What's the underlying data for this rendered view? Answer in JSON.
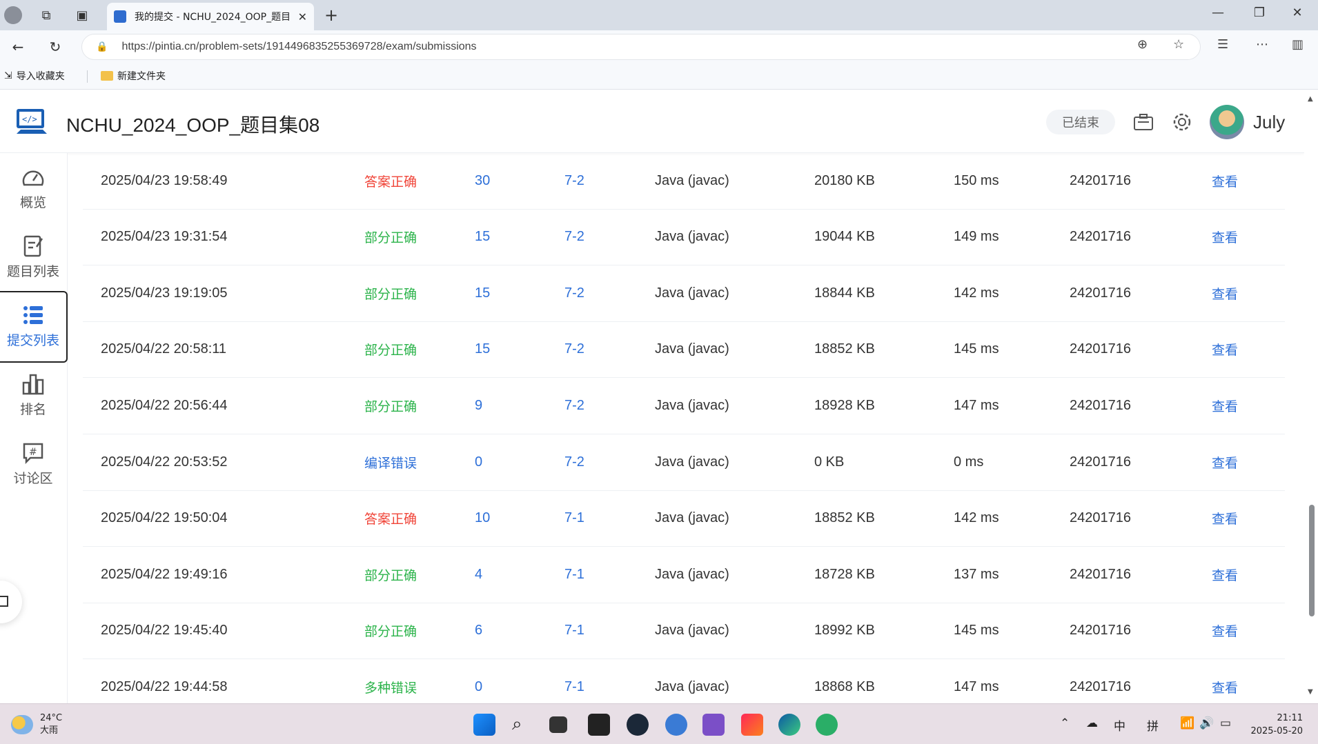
{
  "browser": {
    "tab_title": "我的提交 - NCHU_2024_OOP_题目",
    "url": "https://pintia.cn/problem-sets/1914496835255369728/exam/submissions",
    "bookmarks": [
      "导入收藏夹",
      "新建文件夹"
    ]
  },
  "header": {
    "title": "NCHU_2024_OOP_题目集08",
    "status": "已结束",
    "username": "July"
  },
  "sidebar": {
    "items": [
      {
        "label": "概览",
        "icon": "dashboard-icon"
      },
      {
        "label": "题目列表",
        "icon": "edit-list-icon"
      },
      {
        "label": "提交列表",
        "icon": "list-icon",
        "active": true
      },
      {
        "label": "排名",
        "icon": "ranking-icon"
      },
      {
        "label": "讨论区",
        "icon": "discussion-icon"
      }
    ]
  },
  "submissions": [
    {
      "time": "2025/04/23 19:58:49",
      "status": "答案正确",
      "status_color": "#f04438",
      "score": "30",
      "problem": "7-2",
      "lang": "Java (javac)",
      "memory": "20180 KB",
      "duration": "150 ms",
      "user": "24201716",
      "action": "查看"
    },
    {
      "time": "2025/04/23 19:31:54",
      "status": "部分正确",
      "status_color": "#2bb34a",
      "score": "15",
      "problem": "7-2",
      "lang": "Java (javac)",
      "memory": "19044 KB",
      "duration": "149 ms",
      "user": "24201716",
      "action": "查看"
    },
    {
      "time": "2025/04/23 19:19:05",
      "status": "部分正确",
      "status_color": "#2bb34a",
      "score": "15",
      "problem": "7-2",
      "lang": "Java (javac)",
      "memory": "18844 KB",
      "duration": "142 ms",
      "user": "24201716",
      "action": "查看"
    },
    {
      "time": "2025/04/22 20:58:11",
      "status": "部分正确",
      "status_color": "#2bb34a",
      "score": "15",
      "problem": "7-2",
      "lang": "Java (javac)",
      "memory": "18852 KB",
      "duration": "145 ms",
      "user": "24201716",
      "action": "查看"
    },
    {
      "time": "2025/04/22 20:56:44",
      "status": "部分正确",
      "status_color": "#2bb34a",
      "score": "9",
      "problem": "7-2",
      "lang": "Java (javac)",
      "memory": "18928 KB",
      "duration": "147 ms",
      "user": "24201716",
      "action": "查看"
    },
    {
      "time": "2025/04/22 20:53:52",
      "status": "编译错误",
      "status_color": "#2d6fd8",
      "score": "0",
      "problem": "7-2",
      "lang": "Java (javac)",
      "memory": "0 KB",
      "duration": "0 ms",
      "user": "24201716",
      "action": "查看"
    },
    {
      "time": "2025/04/22 19:50:04",
      "status": "答案正确",
      "status_color": "#f04438",
      "score": "10",
      "problem": "7-1",
      "lang": "Java (javac)",
      "memory": "18852 KB",
      "duration": "142 ms",
      "user": "24201716",
      "action": "查看"
    },
    {
      "time": "2025/04/22 19:49:16",
      "status": "部分正确",
      "status_color": "#2bb34a",
      "score": "4",
      "problem": "7-1",
      "lang": "Java (javac)",
      "memory": "18728 KB",
      "duration": "137 ms",
      "user": "24201716",
      "action": "查看"
    },
    {
      "time": "2025/04/22 19:45:40",
      "status": "部分正确",
      "status_color": "#2bb34a",
      "score": "6",
      "problem": "7-1",
      "lang": "Java (javac)",
      "memory": "18992 KB",
      "duration": "145 ms",
      "user": "24201716",
      "action": "查看"
    },
    {
      "time": "2025/04/22 19:44:58",
      "status": "多种错误",
      "status_color": "#2bb34a",
      "score": "0",
      "problem": "7-1",
      "lang": "Java (javac)",
      "memory": "18868 KB",
      "duration": "147 ms",
      "user": "24201716",
      "action": "查看"
    }
  ],
  "taskbar": {
    "temperature": "24°C",
    "weather": "大雨",
    "ime_lang": "中",
    "ime_mode": "拼",
    "time": "21:11",
    "date": "2025-05-20"
  }
}
